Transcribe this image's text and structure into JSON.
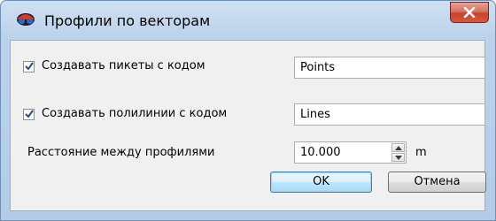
{
  "window": {
    "title": "Профили по векторам",
    "icons": {
      "app": "eye-glasses-icon",
      "close": "close-icon"
    }
  },
  "form": {
    "points": {
      "label": "Создавать пикеты с кодом",
      "checked": true,
      "value": "Points"
    },
    "lines": {
      "label": "Создавать полилинии с кодом",
      "checked": true,
      "value": "Lines"
    },
    "distance": {
      "label": "Расстояние между профилями",
      "value": "10.000",
      "unit": "m"
    }
  },
  "buttons": {
    "ok": "OK",
    "cancel": "Отмена"
  },
  "colors": {
    "close_button": "#c7432c",
    "ok_border": "#3c7fb1",
    "frame": "#bcd2ec"
  }
}
